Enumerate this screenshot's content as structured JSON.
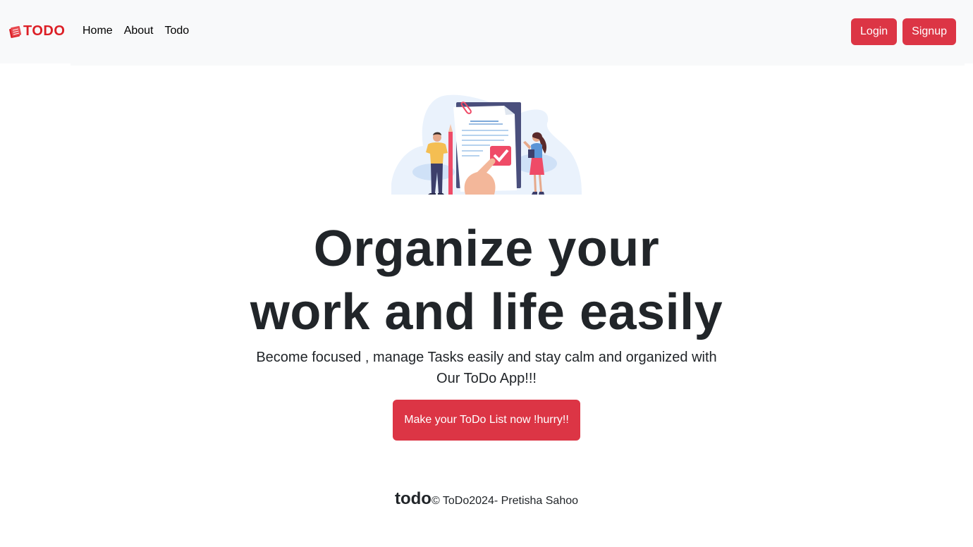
{
  "navbar": {
    "brand": "TODO",
    "links": [
      "Home",
      "About",
      "Todo"
    ],
    "login_label": "Login",
    "signup_label": "Signup"
  },
  "hero": {
    "image_icon": "todo-checklist-illustration",
    "headline_line1": "Organize your",
    "headline_line2": "work and life easily",
    "lead": "Become focused , manage Tasks easily and stay calm and organized with Our ToDo App!!!",
    "cta_label": "Make your ToDo List now !hurry!!"
  },
  "footer": {
    "brand": "todo",
    "copyright": "© ToDo2024- Pretisha Sahoo"
  },
  "colors": {
    "accent": "#dc3545",
    "brand": "#dc1f26",
    "navbar_bg": "#f8f9fa",
    "text": "#212529"
  }
}
